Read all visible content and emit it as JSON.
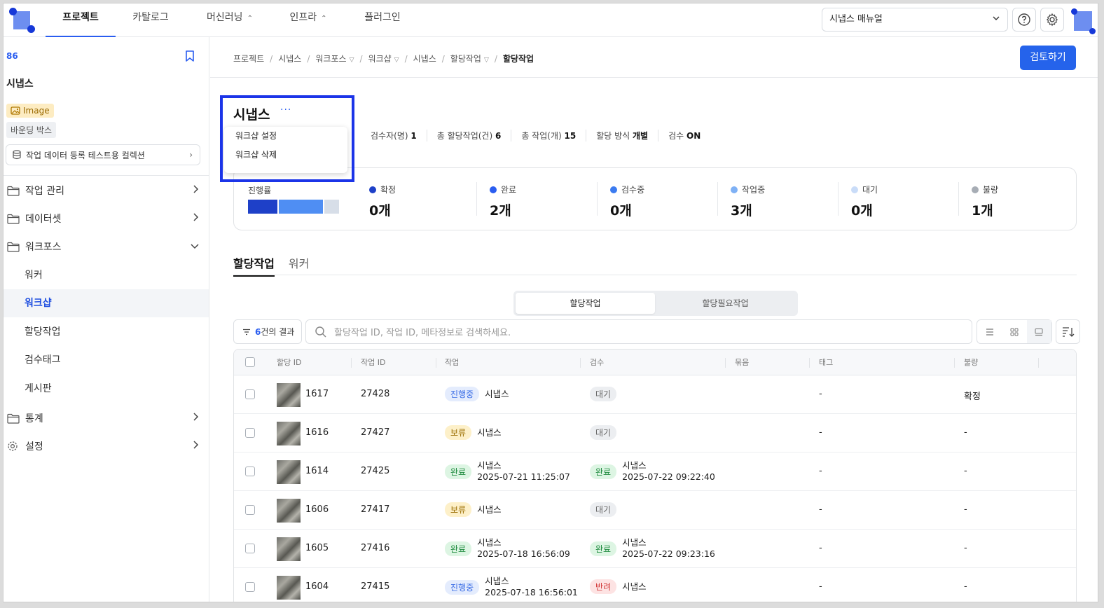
{
  "nav": {
    "tabs": [
      {
        "label": "프로젝트"
      },
      {
        "label": "카탈로그"
      },
      {
        "label": "머신러닝"
      },
      {
        "label": "인프라"
      },
      {
        "label": "플러그인"
      }
    ],
    "manual_select": "시냅스 매뉴얼"
  },
  "sidebar": {
    "project_id": "86",
    "project_name": "시냅스",
    "badge_image": "Image",
    "badge_box": "바운딩 박스",
    "collection": "작업 데이터 등록 테스트용 컬렉션",
    "items": [
      {
        "label": "작업 관리"
      },
      {
        "label": "데이터셋"
      },
      {
        "label": "워크포스"
      },
      {
        "label": "통계"
      },
      {
        "label": "설정"
      }
    ],
    "sub_items": [
      {
        "label": "워커"
      },
      {
        "label": "워크샵"
      },
      {
        "label": "할당작업"
      },
      {
        "label": "검수태그"
      },
      {
        "label": "게시판"
      }
    ]
  },
  "breadcrumb": [
    "프로젝트",
    "시냅스",
    "워크포스",
    "워크샵",
    "시냅스",
    "할당작업",
    "할당작업"
  ],
  "review_button": "검토하기",
  "workshop": {
    "title": "시냅스",
    "more": "···",
    "menu": [
      "워크샵 설정",
      "워크샵 삭제"
    ],
    "meta": [
      {
        "label": "검수자(명)",
        "value": "1"
      },
      {
        "label": "총 할당작업(건)",
        "value": "6"
      },
      {
        "label": "총 작업(개)",
        "value": "15"
      },
      {
        "label": "할당 방식",
        "value": "개별"
      },
      {
        "label": "검수",
        "value": "ON"
      }
    ]
  },
  "progress": {
    "label": "진행률",
    "segments": [
      {
        "share": 0.33,
        "color": "#1e40c8"
      },
      {
        "share": 0.5,
        "color": "#4f8ef3"
      },
      {
        "share": 0.17,
        "color": "#d7dee8"
      }
    ],
    "stats": [
      {
        "label": "확정",
        "value": "0개",
        "color": "#1e40c8"
      },
      {
        "label": "완료",
        "value": "2개",
        "color": "#2a5df0"
      },
      {
        "label": "검수중",
        "value": "0개",
        "color": "#3b7bf0"
      },
      {
        "label": "작업중",
        "value": "3개",
        "color": "#7fb1f5"
      },
      {
        "label": "대기",
        "value": "0개",
        "color": "#c9dcf8"
      },
      {
        "label": "불량",
        "value": "1개",
        "color": "#a7adb5"
      }
    ]
  },
  "tabs": [
    {
      "label": "할당작업"
    },
    {
      "label": "워커"
    }
  ],
  "toggle": {
    "on": "할당작업",
    "off": "할당필요작업"
  },
  "filter": {
    "count": "6",
    "suffix": "건의 결과"
  },
  "search": {
    "placeholder": "할당작업 ID, 작업 ID, 메타정보로 검색하세요."
  },
  "table": {
    "headers": [
      "할당 ID",
      "작업 ID",
      "작업",
      "검수",
      "묶음",
      "태그",
      "불량"
    ],
    "rows": [
      {
        "assign_id": "1617",
        "task_id": "27428",
        "work_status": "진행중",
        "work_status_type": "prog",
        "work_name": "시냅스",
        "work_date": "",
        "review_status": "대기",
        "review_status_type": "wait",
        "review_name": "",
        "review_date": "",
        "tag": "-",
        "defect": "확정"
      },
      {
        "assign_id": "1616",
        "task_id": "27427",
        "work_status": "보류",
        "work_status_type": "hold",
        "work_name": "시냅스",
        "work_date": "",
        "review_status": "대기",
        "review_status_type": "wait",
        "review_name": "",
        "review_date": "",
        "tag": "-",
        "defect": "-"
      },
      {
        "assign_id": "1614",
        "task_id": "27425",
        "work_status": "완료",
        "work_status_type": "done",
        "work_name": "시냅스",
        "work_date": "2025-07-21 11:25:07",
        "review_status": "완료",
        "review_status_type": "done",
        "review_name": "시냅스",
        "review_date": "2025-07-22 09:22:40",
        "tag": "-",
        "defect": "-"
      },
      {
        "assign_id": "1606",
        "task_id": "27417",
        "work_status": "보류",
        "work_status_type": "hold",
        "work_name": "시냅스",
        "work_date": "",
        "review_status": "대기",
        "review_status_type": "wait",
        "review_name": "",
        "review_date": "",
        "tag": "-",
        "defect": "-"
      },
      {
        "assign_id": "1605",
        "task_id": "27416",
        "work_status": "완료",
        "work_status_type": "done",
        "work_name": "시냅스",
        "work_date": "2025-07-18 16:56:09",
        "review_status": "완료",
        "review_status_type": "done",
        "review_name": "시냅스",
        "review_date": "2025-07-22 09:23:16",
        "tag": "-",
        "defect": "-"
      },
      {
        "assign_id": "1604",
        "task_id": "27415",
        "work_status": "진행중",
        "work_status_type": "prog",
        "work_name": "시냅스",
        "work_date": "2025-07-18 16:56:01",
        "review_status": "반려",
        "review_status_type": "rej",
        "review_name": "시냅스",
        "review_date": "",
        "tag": "-",
        "defect": "-"
      }
    ]
  }
}
